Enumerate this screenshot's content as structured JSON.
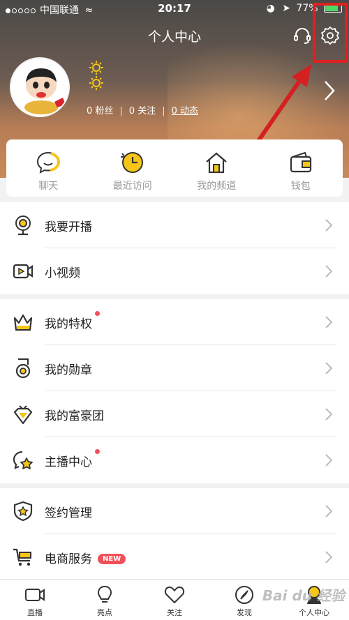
{
  "status_bar": {
    "carrier": "中国联通",
    "time": "20:17",
    "battery": "77%"
  },
  "header": {
    "title": "个人中心"
  },
  "profile": {
    "fans": "0 粉丝",
    "follows": "0 关注",
    "posts": "0 动态"
  },
  "quick_actions": [
    {
      "label": "聊天",
      "icon": "chat-bubble-icon"
    },
    {
      "label": "最近访问",
      "icon": "clock-icon"
    },
    {
      "label": "我的频道",
      "icon": "home-icon"
    },
    {
      "label": "钱包",
      "icon": "wallet-icon"
    }
  ],
  "groups": [
    {
      "items": [
        {
          "label": "我要开播",
          "icon": "webcam-icon"
        },
        {
          "label": "小视频",
          "icon": "video-icon"
        }
      ]
    },
    {
      "items": [
        {
          "label": "我的特权",
          "icon": "crown-icon",
          "red_dot": true
        },
        {
          "label": "我的勋章",
          "icon": "medal-icon"
        },
        {
          "label": "我的富豪团",
          "icon": "diamond-icon"
        },
        {
          "label": "主播中心",
          "icon": "anchor-star-icon",
          "red_dot": true
        }
      ]
    },
    {
      "items": [
        {
          "label": "签约管理",
          "icon": "shield-star-icon"
        },
        {
          "label": "电商服务",
          "icon": "cart-icon",
          "badge": "NEW"
        }
      ]
    }
  ],
  "tabbar": [
    {
      "label": "直播",
      "icon": "camera-icon"
    },
    {
      "label": "亮点",
      "icon": "bulb-icon"
    },
    {
      "label": "关注",
      "icon": "heart-icon"
    },
    {
      "label": "发现",
      "icon": "compass-icon"
    },
    {
      "label": "个人中心",
      "icon": "person-icon",
      "active": true
    }
  ],
  "colors": {
    "accent": "#f5c518",
    "annotation": "#e02020"
  },
  "watermark": "Bai du 经验"
}
